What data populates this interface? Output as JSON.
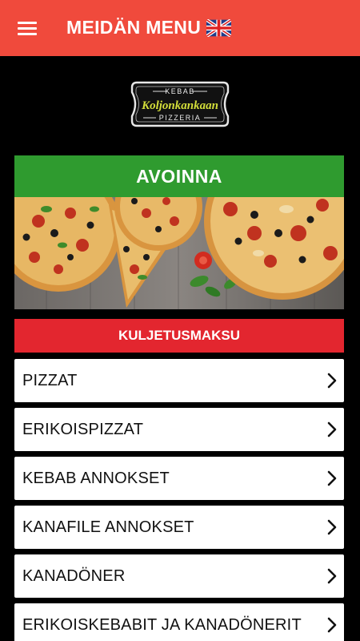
{
  "appbar": {
    "title": "MEIDÄN MENU",
    "menu_icon": "hamburger-menu-icon",
    "language_icon": "uk-flag-icon"
  },
  "logo": {
    "top_text": "KEBAB",
    "name": "Koljonkankaan",
    "bottom_text": "PIZZERIA"
  },
  "status": {
    "label": "AVOINNA",
    "color": "#2f9b2f"
  },
  "delivery": {
    "label": "KULJETUSMAKSU",
    "color": "#e3262f"
  },
  "menu": {
    "items": [
      {
        "label": "PIZZAT"
      },
      {
        "label": "ERIKOISPIZZAT"
      },
      {
        "label": "KEBAB ANNOKSET"
      },
      {
        "label": "KANAFILE ANNOKSET"
      },
      {
        "label": "KANADÖNER"
      },
      {
        "label": "ERIKOISKEBABIT JA KANADÖNERIT"
      }
    ],
    "chevron_icon": "chevron-right-icon"
  },
  "colors": {
    "accent": "#f04a3c",
    "background": "#000000"
  }
}
